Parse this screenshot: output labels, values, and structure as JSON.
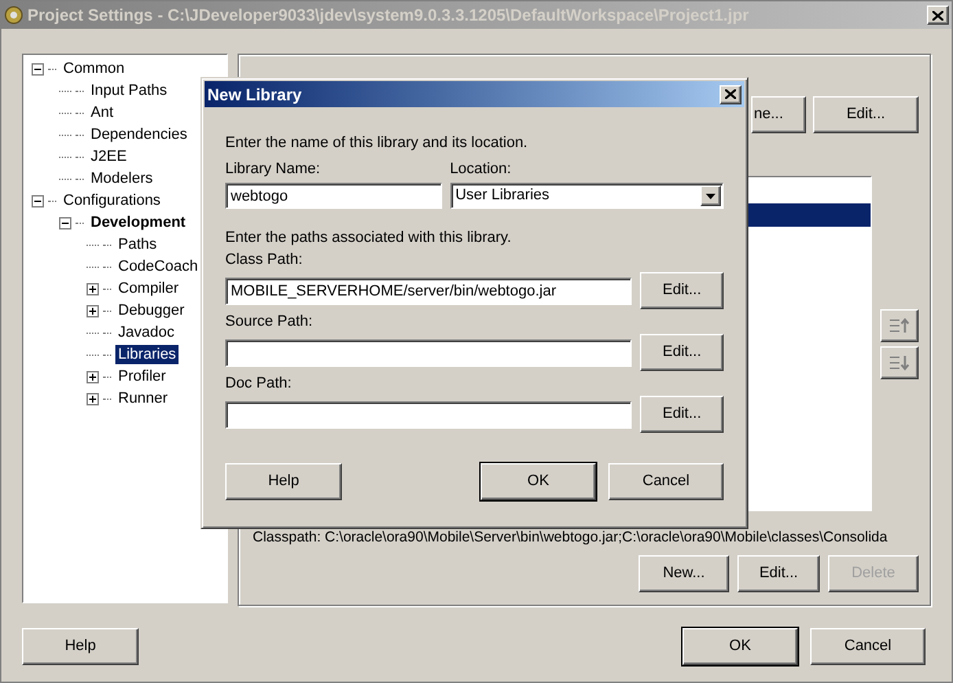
{
  "window": {
    "title": "Project Settings - C:\\JDeveloper9033\\jdev\\system9.0.3.3.1205\\DefaultWorkspace\\Project1.jpr"
  },
  "tree": [
    {
      "label": "Common",
      "expanded": true,
      "bold": false,
      "selected": false,
      "children": [
        {
          "label": "Input Paths",
          "selected": false,
          "bold": false
        },
        {
          "label": "Ant",
          "selected": false,
          "bold": false
        },
        {
          "label": "Dependencies",
          "selected": false,
          "bold": false
        },
        {
          "label": "J2EE",
          "selected": false,
          "bold": false
        },
        {
          "label": "Modelers",
          "selected": false,
          "bold": false
        }
      ]
    },
    {
      "label": "Configurations",
      "expanded": true,
      "bold": false,
      "selected": false,
      "children": [
        {
          "label": "Development",
          "expanded": true,
          "bold": true,
          "selected": false,
          "children": [
            {
              "label": "Paths",
              "selected": false,
              "bold": false
            },
            {
              "label": "CodeCoach",
              "selected": false,
              "bold": false
            },
            {
              "label": "Compiler",
              "expanded": false,
              "selected": false,
              "bold": false
            },
            {
              "label": "Debugger",
              "expanded": false,
              "selected": false,
              "bold": false
            },
            {
              "label": "Javadoc",
              "selected": false,
              "bold": false
            },
            {
              "label": "Libraries",
              "selected": true,
              "bold": false
            },
            {
              "label": "Profiler",
              "expanded": false,
              "selected": false,
              "bold": false
            },
            {
              "label": "Runner",
              "expanded": false,
              "selected": false,
              "bold": false
            }
          ]
        }
      ]
    }
  ],
  "libraries_panel": {
    "top_buttons": [
      {
        "label": "ne...",
        "disabled": false
      },
      {
        "label": "Edit...",
        "disabled": false
      }
    ],
    "library_list": [
      {
        "selected": true
      }
    ],
    "classpath": "Classpath:  C:\\oracle\\ora90\\Mobile\\Server\\bin\\webtogo.jar;C:\\oracle\\ora90\\Mobile\\classes\\Consolida",
    "buttons": [
      {
        "label": "New...",
        "disabled": false
      },
      {
        "label": "Edit...",
        "disabled": false
      },
      {
        "label": "Delete",
        "disabled": true
      }
    ]
  },
  "footer_buttons": {
    "help": "Help",
    "ok": "OK",
    "cancel": "Cancel"
  },
  "dialog": {
    "title": "New Library",
    "intro": "Enter the name of this library and its location.",
    "name_label": "Library Name:",
    "name_value": "webtogo",
    "location_label": "Location:",
    "location_value": "User Libraries",
    "paths_intro": "Enter the paths associated with this library.",
    "paths": [
      {
        "label": "Class Path:",
        "value": "MOBILE_SERVERHOME/server/bin/webtogo.jar",
        "button": "Edit..."
      },
      {
        "label": "Source Path:",
        "button": "Edit..."
      },
      {
        "label": "Doc Path:",
        "button": "Edit..."
      }
    ],
    "buttons": {
      "help": "Help",
      "ok": "OK",
      "cancel": "Cancel"
    }
  }
}
